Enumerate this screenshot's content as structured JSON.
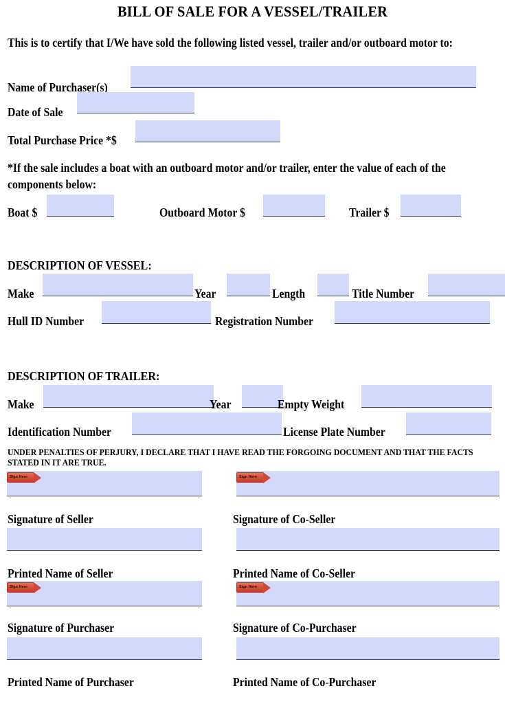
{
  "document": {
    "title": "BILL OF SALE FOR A VESSEL/TRAILER",
    "intro": "This is to certify that I/We have sold the following listed vessel, trailer and/or outboard motor to:",
    "component_note": "*If the sale includes a boat with an outboard motor and/or trailer, enter the value of each of the components below:",
    "perjury_statement": "UNDER PENALTIES OF PERJURY, I DECLARE THAT I HAVE READ THE FORGOING DOCUMENT AND THAT THE FACTS STATED IN IT ARE TRUE."
  },
  "colors": {
    "field_fill": "#d3d9fb",
    "field_rule": "#3b3b4a",
    "sign_tab": "#cf4833",
    "text": "#000000"
  },
  "purchaser_block": {
    "name_label": "Name of Purchaser(s)",
    "name_value": "",
    "date_label": "Date of Sale",
    "date_value": "",
    "price_label": "Total Purchase Price *$",
    "price_value": ""
  },
  "component_values": {
    "boat_label": "Boat $",
    "boat_value": "",
    "outboard_label": "Outboard Motor $",
    "outboard_value": "",
    "trailer_label": "Trailer $",
    "trailer_value": ""
  },
  "vessel": {
    "heading": "DESCRIPTION OF VESSEL:",
    "make_label": "Make",
    "make_value": "",
    "year_label": "Year",
    "year_value": "",
    "length_label": "Length",
    "length_value": "",
    "title_number_label": "Title Number",
    "title_number_value": "",
    "hull_id_label": "Hull ID Number",
    "hull_id_value": "",
    "registration_label": "Registration Number",
    "registration_value": ""
  },
  "trailer": {
    "heading": "DESCRIPTION OF TRAILER:",
    "make_label": "Make",
    "make_value": "",
    "year_label": "Year",
    "year_value": "",
    "empty_weight_label": "Empty Weight",
    "empty_weight_value": "",
    "identification_label": "Identification Number",
    "identification_value": "",
    "license_plate_label": "License Plate Number",
    "license_plate_value": ""
  },
  "signatures": {
    "sign_tab_label": "Sign Here",
    "seller_signature_label": "Signature of Seller",
    "seller_signature_value": "",
    "co_seller_signature_label": "Signature of Co-Seller",
    "co_seller_signature_value": "",
    "seller_printed_label": "Printed Name of Seller",
    "seller_printed_value": "",
    "co_seller_printed_label": "Printed Name of Co-Seller",
    "co_seller_printed_value": "",
    "purchaser_signature_label": "Signature of Purchaser",
    "purchaser_signature_value": "",
    "co_purchaser_signature_label": "Signature of Co-Purchaser",
    "co_purchaser_signature_value": "",
    "purchaser_printed_label": "Printed Name of Purchaser",
    "purchaser_printed_value": "",
    "co_purchaser_printed_label": "Printed Name of Co-Purchaser",
    "co_purchaser_printed_value": ""
  }
}
